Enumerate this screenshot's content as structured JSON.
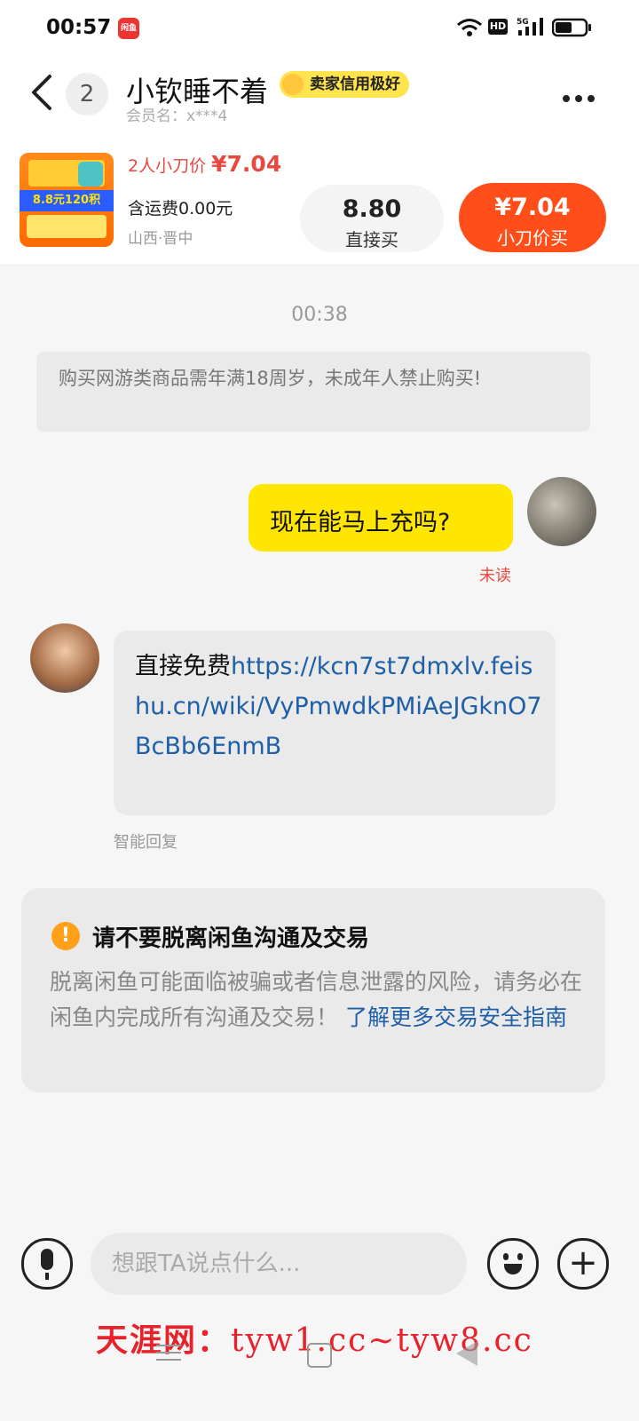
{
  "status_bar": {
    "time": "00:57",
    "app_badge": "闲鱼",
    "network": "HD",
    "signal": "5G"
  },
  "header": {
    "unread_count": "2",
    "contact_name": "小钦睡不着",
    "credit_badge": "卖家信用极好",
    "member_label": "会员名：",
    "member_id": "x***4"
  },
  "product": {
    "cut_price_label": "2人小刀价",
    "cut_price": "¥7.04",
    "shipping": "含运费0.00元",
    "location": "山西·晋中",
    "thumb_text": "8.8元120积",
    "direct_buy_price": "8.80",
    "direct_buy_label": "直接买",
    "cut_buy_price": "¥7.04",
    "cut_buy_label": "小刀价买"
  },
  "chat": {
    "timestamp": "00:38",
    "system_notice": "购买网游类商品需年满18周岁，未成年人禁止购买!",
    "my_message": "现在能马上充吗?",
    "my_message_status": "未读",
    "their_message_prefix": "直接免费",
    "their_message_link": "https://kcn7st7dmxlv.feishu.cn/wiki/VyPmwdkPMiAeJGknO7BcBb6EnmB",
    "smart_reply_label": "智能回复"
  },
  "warning": {
    "title": "请不要脱离闲鱼沟通及交易",
    "body": "脱离闲鱼可能面临被骗或者信息泄露的风险，请务必在闲鱼内完成所有沟通及交易！",
    "link": "了解更多交易安全指南"
  },
  "input": {
    "placeholder": "想跟TA说点什么..."
  },
  "watermark": {
    "chinese": "天涯网：",
    "latin": "tyw1.cc~tyw8.cc"
  },
  "colors": {
    "accent_orange": "#ff4e1a",
    "bubble_yellow": "#ffe600",
    "price_red": "#e8483f",
    "link_blue": "#1e5fa8"
  }
}
